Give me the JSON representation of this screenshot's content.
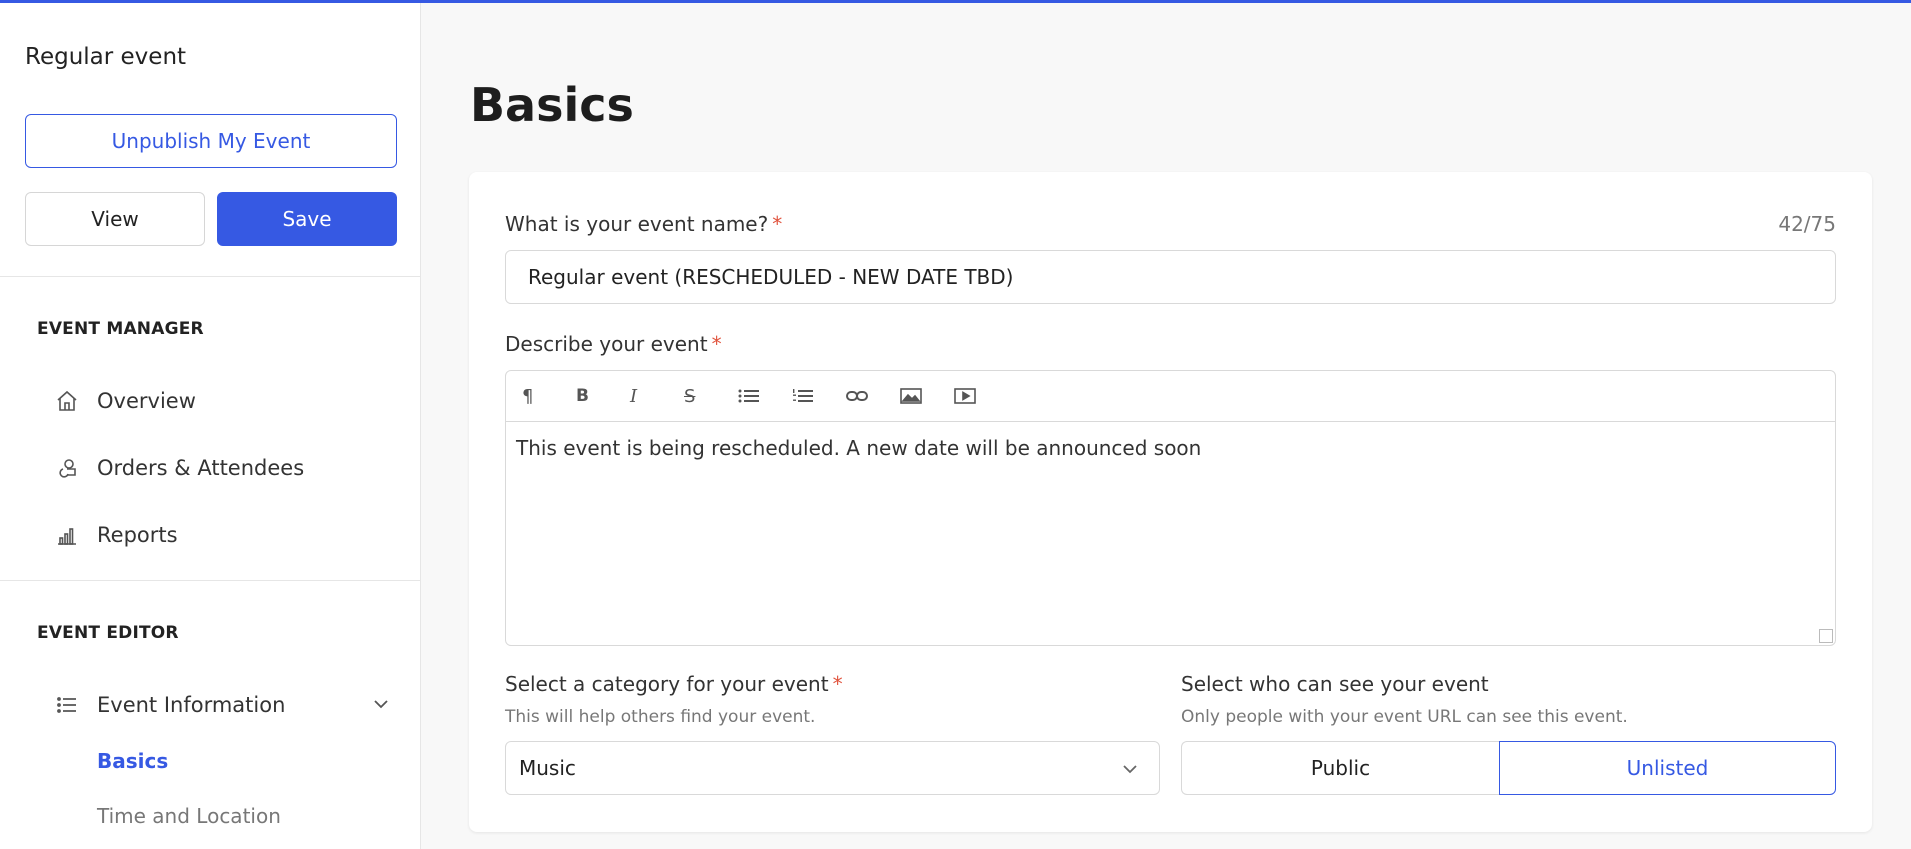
{
  "sidebar": {
    "event_title": "Regular event",
    "unpublish_label": "Unpublish My Event",
    "view_label": "View",
    "save_label": "Save",
    "event_manager": {
      "heading": "EVENT MANAGER",
      "items": [
        {
          "label": "Overview",
          "icon": "home-icon"
        },
        {
          "label": "Orders & Attendees",
          "icon": "attendees-icon"
        },
        {
          "label": "Reports",
          "icon": "bar-chart-icon"
        }
      ]
    },
    "event_editor": {
      "heading": "EVENT EDITOR",
      "section": {
        "label": "Event Information",
        "icon": "list-icon",
        "expanded": true
      },
      "sub_items": [
        {
          "label": "Basics",
          "active": true
        },
        {
          "label": "Time and Location",
          "active": false
        }
      ]
    }
  },
  "main": {
    "page_title": "Basics",
    "name_field": {
      "label": "What is your event name?",
      "required_mark": "*",
      "counter": "42/75",
      "value": "Regular event (RESCHEDULED - NEW DATE TBD)"
    },
    "description_field": {
      "label": "Describe your event",
      "required_mark": "*",
      "toolbar": [
        "paragraph-icon",
        "bold-icon",
        "italic-icon",
        "strikethrough-icon",
        "bullet-list-icon",
        "numbered-list-icon",
        "link-icon",
        "image-icon",
        "video-icon"
      ],
      "value": "This event is being rescheduled. A new date will be announced soon"
    },
    "category_field": {
      "label": "Select a category for your event",
      "required_mark": "*",
      "hint": "This will help others find your event.",
      "value": "Music"
    },
    "visibility_field": {
      "label": "Select who can see your event",
      "hint": "Only people with your event URL can see this event.",
      "options": [
        "Public",
        "Unlisted"
      ],
      "selected": "Unlisted"
    }
  },
  "colors": {
    "accent": "#3659e3",
    "required": "#e0523c"
  }
}
